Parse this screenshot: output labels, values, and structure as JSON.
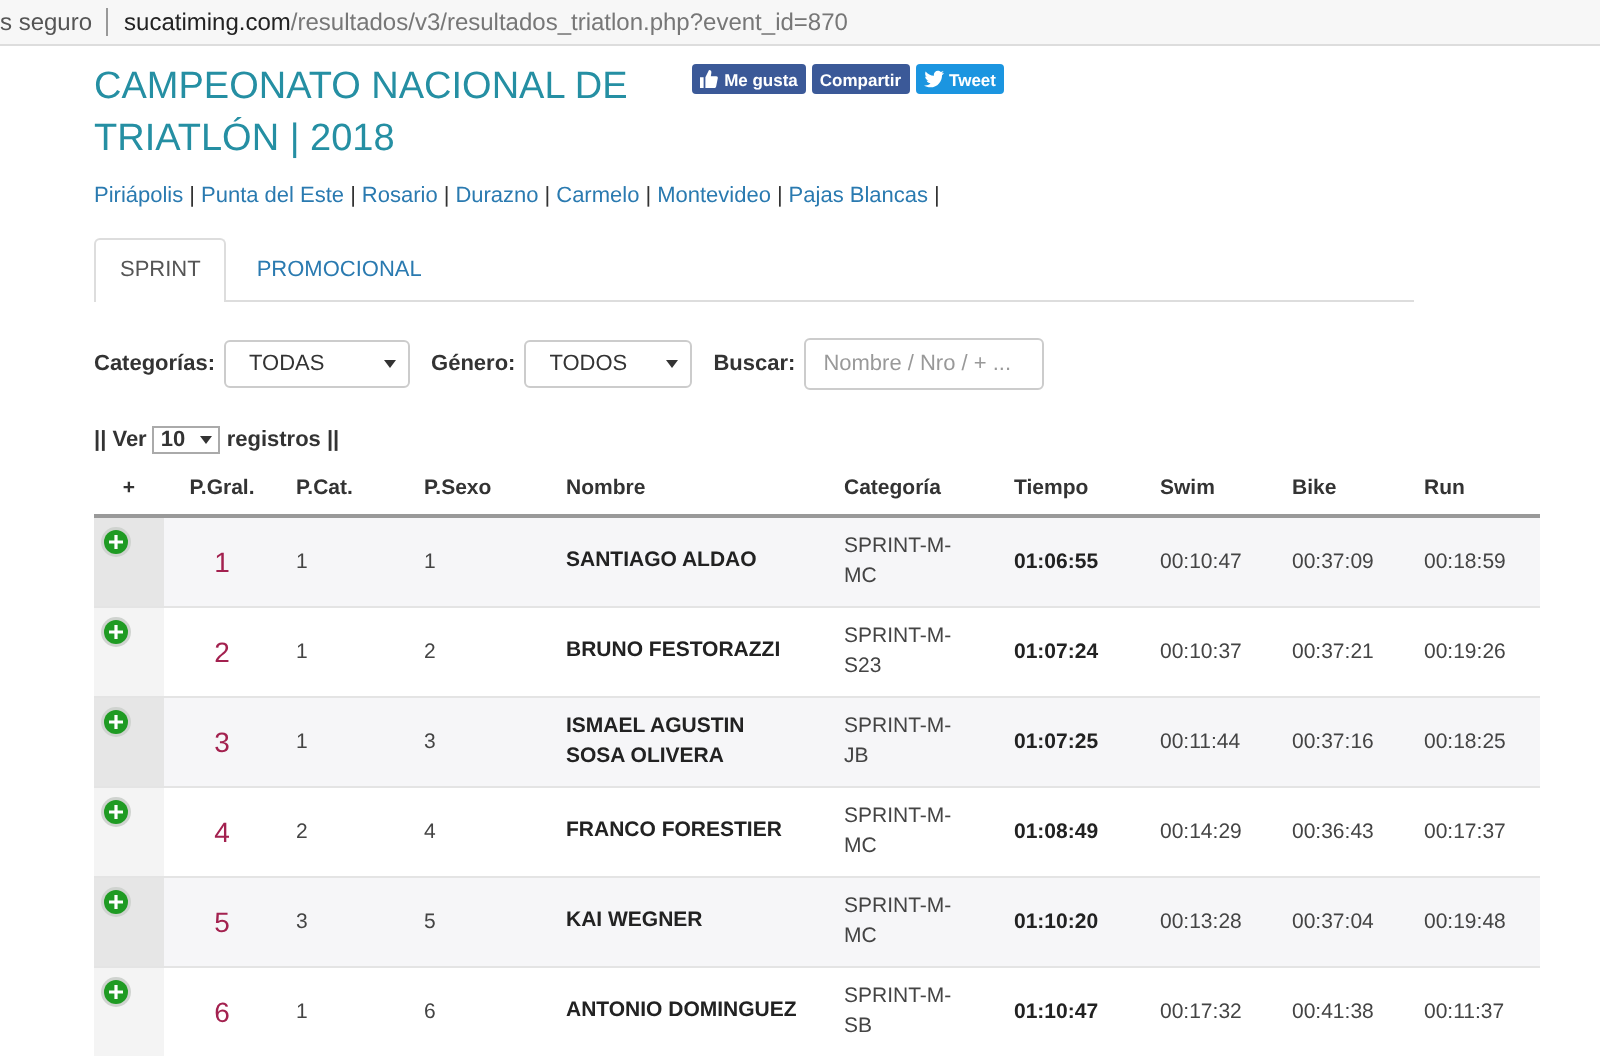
{
  "address_bar": {
    "security": "s seguro",
    "url_host": "sucatiming.com",
    "url_path": "/resultados/v3/resultados_triatlon.php?event_id=870"
  },
  "title": "CAMPEONATO NACIONAL DE TRIATLÓN | 2018",
  "social_buttons": [
    {
      "kind": "like",
      "label": "Me gusta"
    },
    {
      "kind": "share",
      "label": "Compartir"
    },
    {
      "kind": "tweet",
      "label": "Tweet"
    }
  ],
  "locations": {
    "separator": "|",
    "links": [
      "Piriápolis",
      "Punta del Este",
      "Rosario",
      "Durazno",
      "Carmelo",
      "Montevideo",
      "Pajas Blancas"
    ]
  },
  "tabs": [
    {
      "label": "SPRINT",
      "selected": true
    },
    {
      "label": "PROMOCIONAL",
      "selected": false
    }
  ],
  "filters": [
    {
      "label": "Categorías:",
      "kind": "select",
      "value": "TODAS"
    },
    {
      "label": "Género:",
      "kind": "select",
      "value": "TODOS"
    },
    {
      "label": "Buscar:",
      "kind": "search",
      "placeholder": "Nombre / Nro / + ..."
    }
  ],
  "page_size": {
    "before": "|| Ver",
    "value": "10",
    "after": "registros ||"
  },
  "table": {
    "columns": [
      "+",
      "P.Gral.",
      "P.Cat.",
      "P.Sexo",
      "Nombre",
      "Categoría",
      "Tiempo",
      "Swim",
      "Bike",
      "Run"
    ],
    "rows": [
      {
        "gral": "1",
        "cat": "1",
        "sexo": "1",
        "nombre": "SANTIAGO ALDAO",
        "categoria": "SPRINT-M-MC",
        "tiempo": "01:06:55",
        "swim": "00:10:47",
        "bike": "00:37:09",
        "run": "00:18:59"
      },
      {
        "gral": "2",
        "cat": "1",
        "sexo": "2",
        "nombre": "BRUNO FESTORAZZI",
        "categoria": "SPRINT-M-S23",
        "tiempo": "01:07:24",
        "swim": "00:10:37",
        "bike": "00:37:21",
        "run": "00:19:26"
      },
      {
        "gral": "3",
        "cat": "1",
        "sexo": "3",
        "nombre": "ISMAEL AGUSTIN SOSA OLIVERA",
        "categoria": "SPRINT-M-JB",
        "tiempo": "01:07:25",
        "swim": "00:11:44",
        "bike": "00:37:16",
        "run": "00:18:25"
      },
      {
        "gral": "4",
        "cat": "2",
        "sexo": "4",
        "nombre": "FRANCO FORESTIER",
        "categoria": "SPRINT-M-MC",
        "tiempo": "01:08:49",
        "swim": "00:14:29",
        "bike": "00:36:43",
        "run": "00:17:37"
      },
      {
        "gral": "5",
        "cat": "3",
        "sexo": "5",
        "nombre": "KAI WEGNER",
        "categoria": "SPRINT-M-MC",
        "tiempo": "01:10:20",
        "swim": "00:13:28",
        "bike": "00:37:04",
        "run": "00:19:48"
      },
      {
        "gral": "6",
        "cat": "1",
        "sexo": "6",
        "nombre": "ANTONIO DOMINGUEZ",
        "categoria": "SPRINT-M-SB",
        "tiempo": "01:10:47",
        "swim": "00:17:32",
        "bike": "00:41:38",
        "run": "00:11:37"
      }
    ]
  }
}
